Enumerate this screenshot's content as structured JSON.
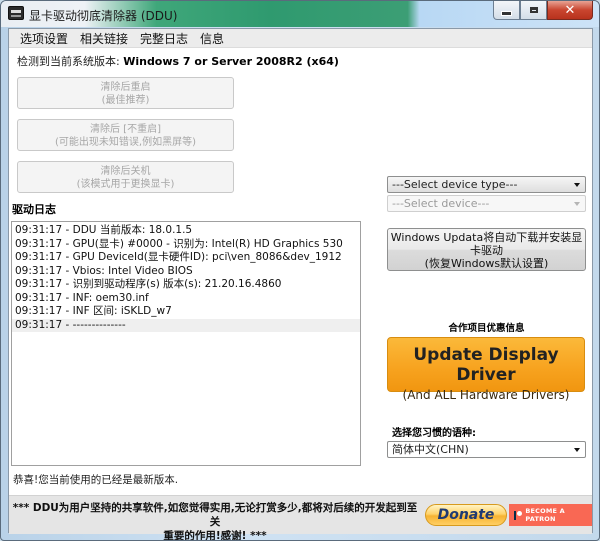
{
  "window": {
    "title": "显卡驱动彻底清除器 (DDU)",
    "controls": {
      "minimize": "minimize",
      "maximize": "maximize",
      "close": "✕"
    }
  },
  "menu": [
    "选项设置",
    "相关链接",
    "完整日志",
    "信息"
  ],
  "os_detect": {
    "label": "检测到当前系统版本: ",
    "value": "Windows 7 or Server 2008R2 (x64)"
  },
  "actions": [
    {
      "line1": "清除后重启",
      "line2": "(最佳推荐)",
      "enabled": false
    },
    {
      "line1": "清除后 [不重启]",
      "line2": "(可能出现未知错误,例如黑屏等)",
      "enabled": false
    },
    {
      "line1": "清除后关机",
      "line2": "(该模式用于更换显卡)",
      "enabled": false
    }
  ],
  "log": {
    "label": "驱动日志",
    "lines": [
      "09:31:17 - DDU 当前版本: 18.0.1.5",
      "09:31:17 - GPU(显卡) #0000 - 识别为: Intel(R) HD Graphics 530",
      "09:31:17 - GPU DeviceId(显卡硬件ID): pci\\ven_8086&dev_1912",
      "09:31:17 - Vbios: Intel Video BIOS",
      "09:31:17 - 识别到驱动程序(s) 版本(s): 21.20.16.4860",
      "09:31:17 - INF: oem30.inf",
      "09:31:17 - INF 区间: iSKLD_w7",
      "09:31:17 - --------------"
    ],
    "selected_index": 7
  },
  "status_message": "恭喜!您当前使用的已经是最新版本.",
  "device_type_select": {
    "value": "---Select device type---"
  },
  "device_select": {
    "value": "---Select device---",
    "enabled": false
  },
  "windows_update_button": {
    "line1": "Windows Updata将自动下载并安装显",
    "line2": "卡驱动",
    "line3": "(恢复Windows默认设置)"
  },
  "partner": {
    "label": "合作项目优惠信息",
    "button_line1": "Update Display Driver",
    "button_line2": "(And ALL Hardware Drivers)"
  },
  "language": {
    "label": "选择您习惯的语种:",
    "value": "简体中文(CHN)"
  },
  "footer": {
    "line1": "*** DDU为用户坚持的共享软件,如您觉得实用,无论打赏多少,都将对后续的开发起到至关",
    "line2": "重要的作用!感谢! ***",
    "donate_label": "Donate",
    "patron_label": "BECOME A PATRON"
  },
  "colors": {
    "update_button": "#f7a21e",
    "patron": "#f96854",
    "donate": "#ffcf63"
  }
}
